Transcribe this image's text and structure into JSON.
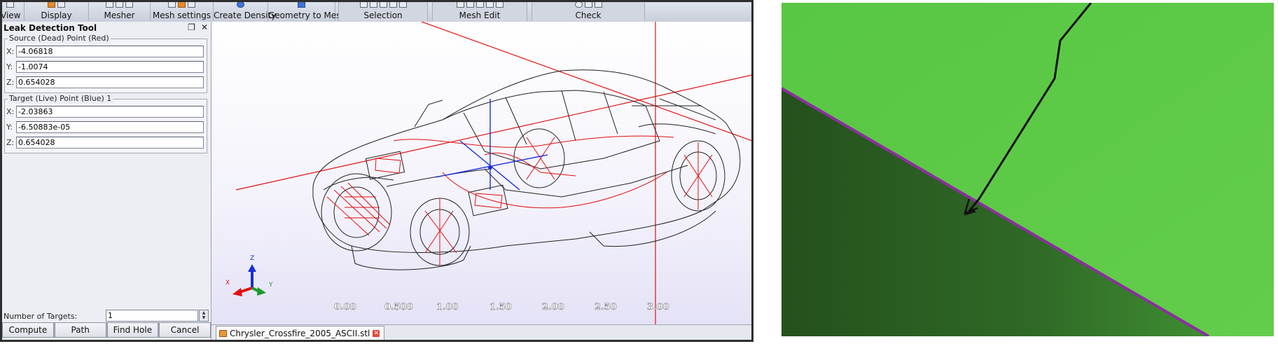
{
  "ribbon": {
    "groups": [
      {
        "label": "View"
      },
      {
        "label": "Display"
      },
      {
        "label": "Mesher"
      },
      {
        "label": "Mesh settings"
      },
      {
        "label": "Create Density"
      },
      {
        "label": "Geometry to Mesh"
      },
      {
        "label": "Selection"
      },
      {
        "label": "Mesh Edit"
      },
      {
        "label": "Check"
      }
    ]
  },
  "panel": {
    "title": "Leak Detection Tool",
    "source": {
      "legend": "Source (Dead) Point (Red)",
      "x": "-4.06818",
      "y": "-1.0074",
      "z": "0.654028"
    },
    "target": {
      "legend": "Target (Live) Point (Blue) 1",
      "x": "-2.03863",
      "y": "-6.50883e-05",
      "z": "0.654028"
    },
    "axis_labels": {
      "x": "X:",
      "y": "Y:",
      "z": "Z:"
    },
    "num_targets_label": "Number of Targets:",
    "num_targets_value": "1",
    "buttons": {
      "compute": "Compute",
      "path": "Path",
      "find_hole": "Find Hole",
      "cancel": "Cancel"
    }
  },
  "viewport": {
    "scale_ticks": [
      "0.00",
      "0.500",
      "1.00",
      "1.50",
      "2.00",
      "2.50",
      "3.00"
    ],
    "triad": {
      "x": "X",
      "y": "Y",
      "z": "Z"
    },
    "colors": {
      "red_axis": "#e01010",
      "blue_axis": "#1a2ed8",
      "wire": "#222222",
      "wire_red": "#e01010"
    }
  },
  "tab": {
    "label": "Chrysler_Crossfire_2005_ASCII.stl"
  },
  "zoom": {
    "colors": {
      "surface_light": "#5cc846",
      "surface_dark": "#2b5c22",
      "edge": "#8b2f9e",
      "path": "#111111"
    }
  }
}
